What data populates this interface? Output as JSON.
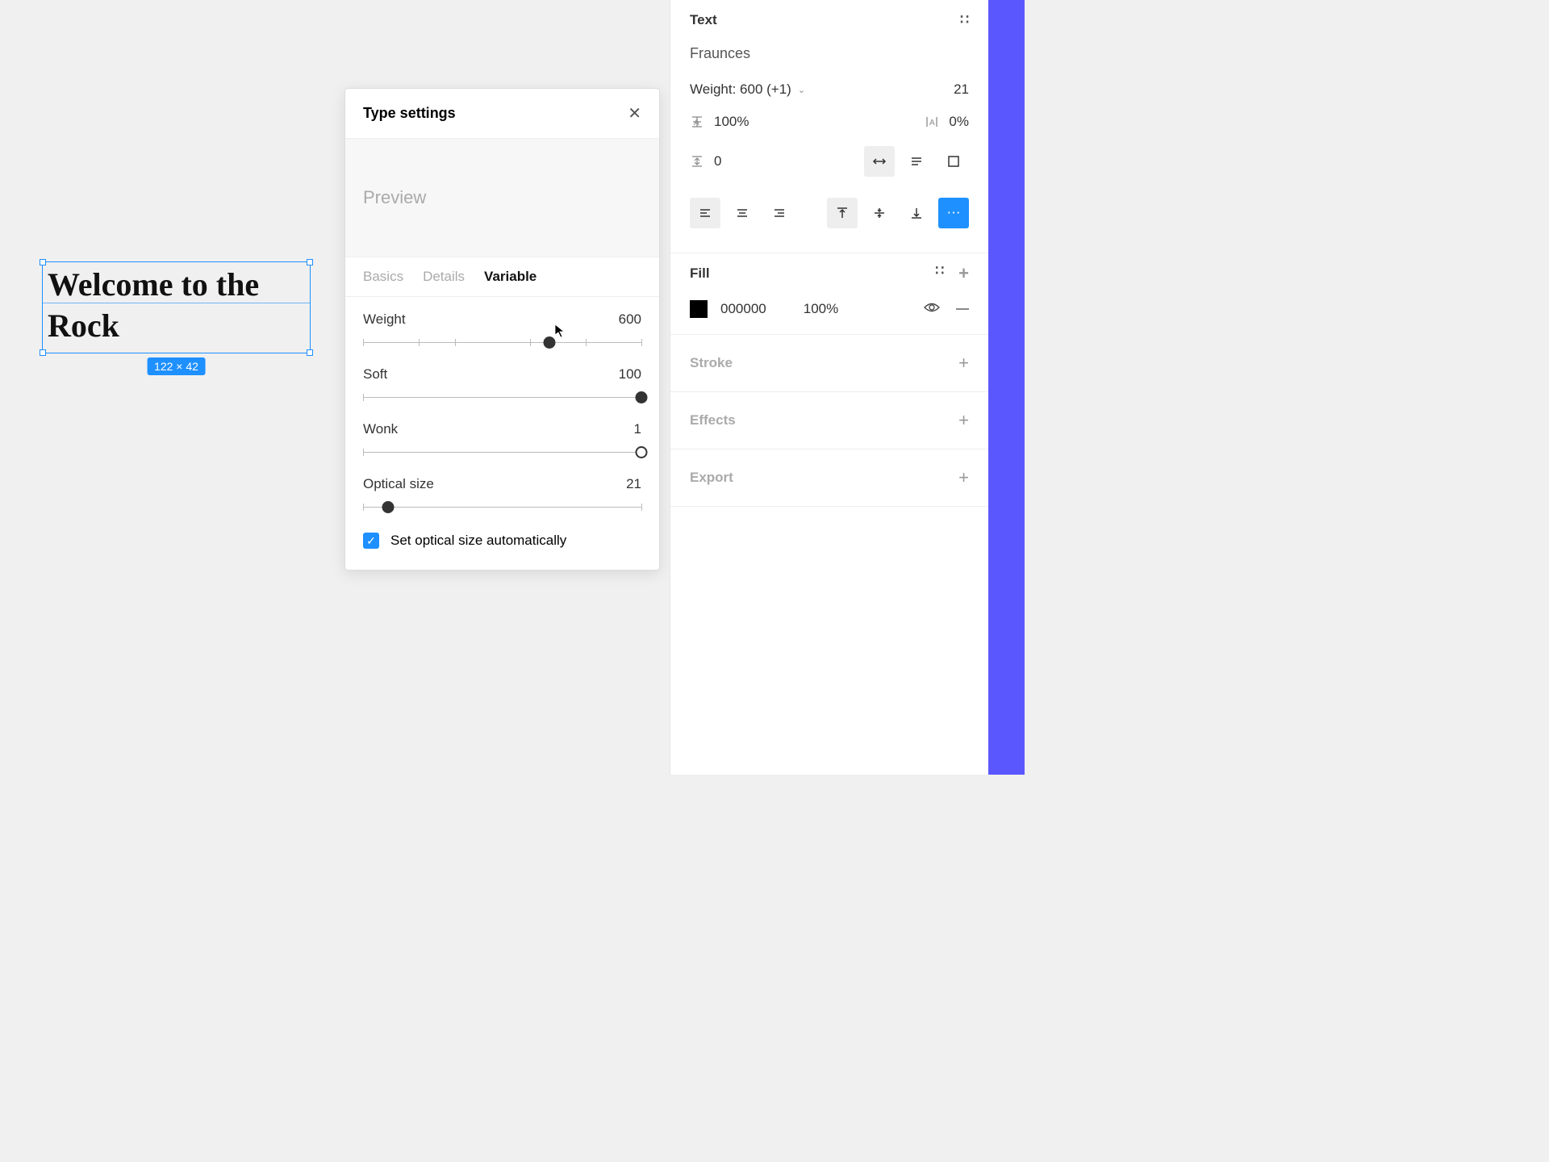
{
  "canvas": {
    "selected_text": "Welcome to the Rock",
    "dimensions_label": "122 × 42"
  },
  "popover": {
    "title": "Type settings",
    "preview_label": "Preview",
    "tabs": {
      "basics": "Basics",
      "details": "Details",
      "variable": "Variable",
      "active": "variable"
    },
    "axes": {
      "weight": {
        "label": "Weight",
        "value": "600",
        "pos_pct": 67
      },
      "soft": {
        "label": "Soft",
        "value": "100",
        "pos_pct": 100
      },
      "wonk": {
        "label": "Wonk",
        "value": "1",
        "pos_pct": 100
      },
      "optical": {
        "label": "Optical size",
        "value": "21",
        "pos_pct": 9
      }
    },
    "checkbox_label": "Set optical size automatically"
  },
  "sidebar": {
    "text": {
      "title": "Text",
      "font": "Fraunces",
      "weight_label": "Weight: 600 (+1)",
      "font_size": "21",
      "line_height": "100%",
      "letter_spacing": "0%",
      "paragraph_spacing": "0"
    },
    "fill": {
      "title": "Fill",
      "hex": "000000",
      "opacity": "100%"
    },
    "stroke": {
      "title": "Stroke"
    },
    "effects": {
      "title": "Effects"
    },
    "export": {
      "title": "Export"
    }
  }
}
